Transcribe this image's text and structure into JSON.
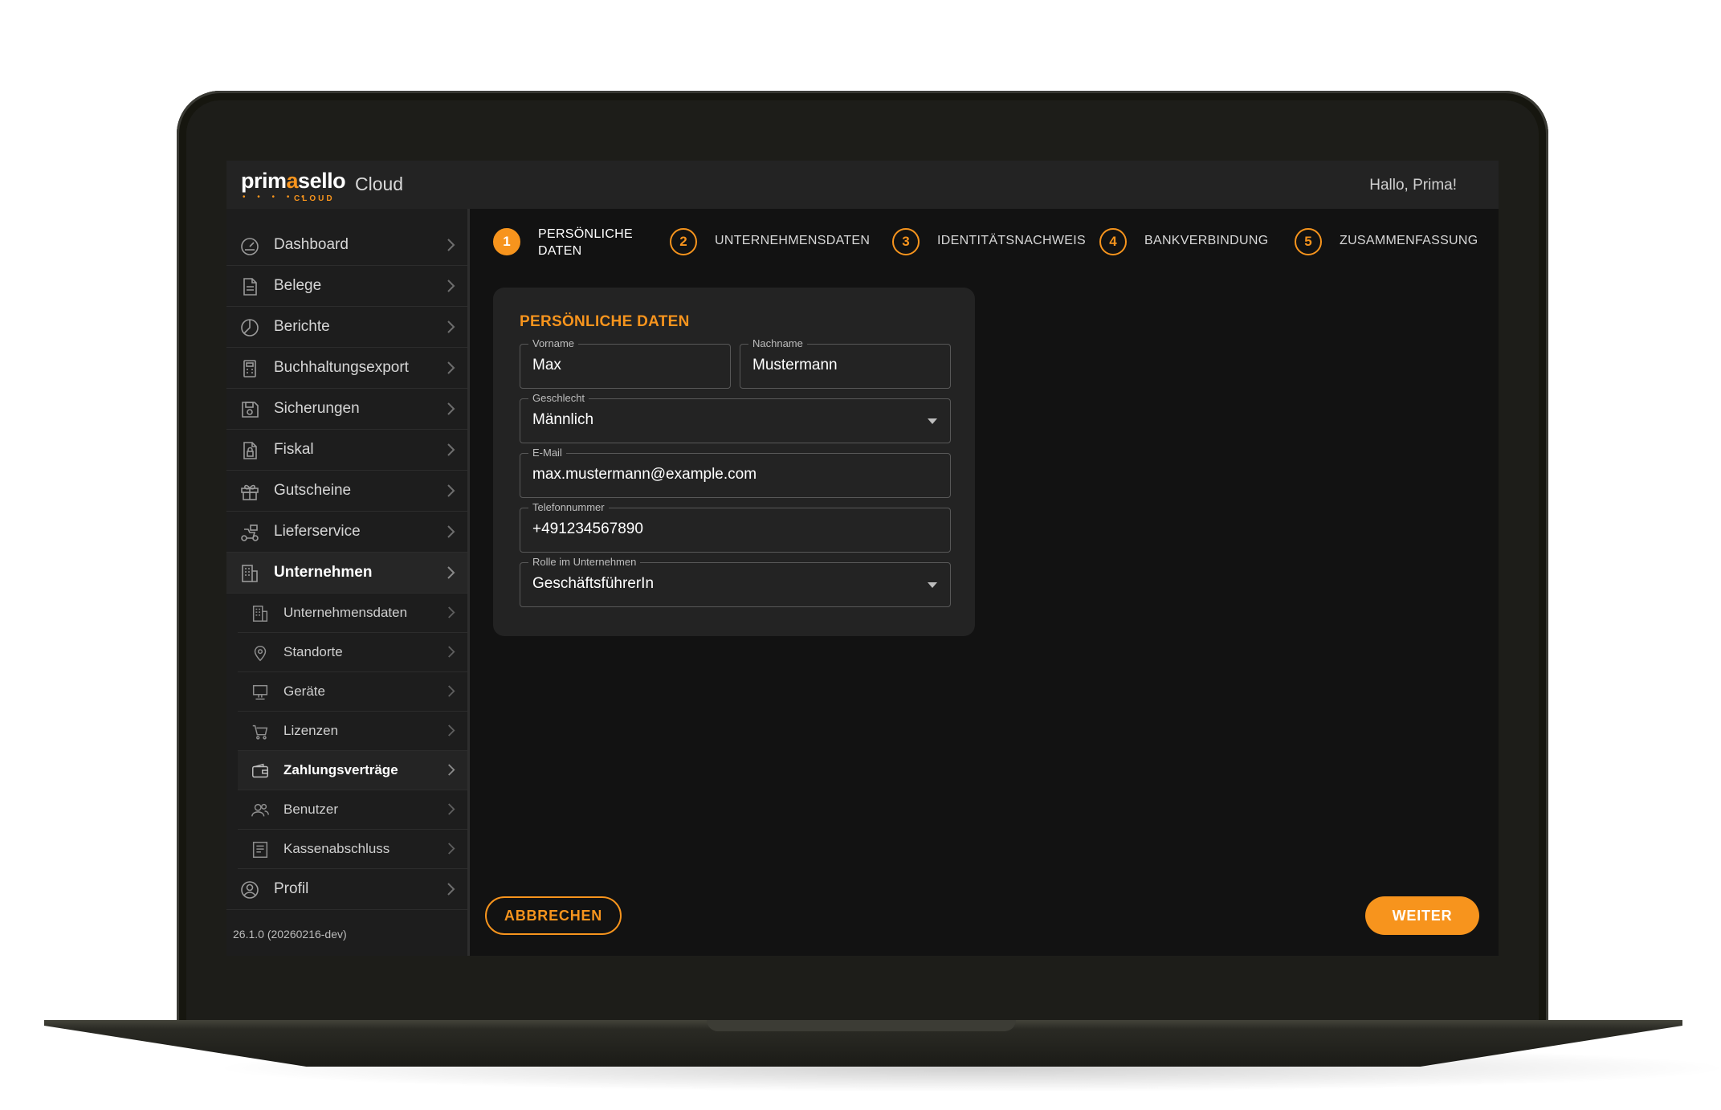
{
  "brand": {
    "logo_word_1": "prim",
    "logo_word_2": "a",
    "logo_word_3": "sello",
    "logo_sub": "CLOUD",
    "app_title": "Cloud"
  },
  "header": {
    "greeting": "Hallo, Prima!"
  },
  "sidebar": {
    "items": [
      {
        "label": "Dashboard",
        "icon": "gauge-icon"
      },
      {
        "label": "Belege",
        "icon": "document-icon"
      },
      {
        "label": "Berichte",
        "icon": "pie-chart-icon"
      },
      {
        "label": "Buchhaltungsexport",
        "icon": "calculator-icon"
      },
      {
        "label": "Sicherungen",
        "icon": "save-disk-icon"
      },
      {
        "label": "Fiskal",
        "icon": "locked-document-icon"
      },
      {
        "label": "Gutscheine",
        "icon": "gift-icon"
      },
      {
        "label": "Lieferservice",
        "icon": "delivery-scooter-icon"
      },
      {
        "label": "Unternehmen",
        "icon": "building-icon"
      }
    ],
    "subitems": [
      {
        "label": "Unternehmensdaten",
        "icon": "building-icon"
      },
      {
        "label": "Standorte",
        "icon": "location-pin-icon"
      },
      {
        "label": "Geräte",
        "icon": "pos-terminal-icon"
      },
      {
        "label": "Lizenzen",
        "icon": "cart-icon"
      },
      {
        "label": "Zahlungsverträge",
        "icon": "wallet-icon"
      },
      {
        "label": "Benutzer",
        "icon": "users-icon"
      },
      {
        "label": "Kassenabschluss",
        "icon": "receipt-icon"
      }
    ],
    "profile": {
      "label": "Profil",
      "icon": "user-circle-icon"
    },
    "version": "26.1.0 (20260216-dev)"
  },
  "stepper": {
    "steps": [
      {
        "number": "1",
        "label": "PERSÖNLICHE DATEN"
      },
      {
        "number": "2",
        "label": "UNTERNEHMENSDATEN"
      },
      {
        "number": "3",
        "label": "IDENTITÄTSNACHWEIS"
      },
      {
        "number": "4",
        "label": "BANKVERBINDUNG"
      },
      {
        "number": "5",
        "label": "ZUSAMMENFASSUNG"
      }
    ],
    "active_step": 1
  },
  "form": {
    "title": "PERSÖNLICHE DATEN",
    "first_name": {
      "label": "Vorname",
      "value": "Max"
    },
    "last_name": {
      "label": "Nachname",
      "value": "Mustermann"
    },
    "gender": {
      "label": "Geschlecht",
      "value": "Männlich"
    },
    "email": {
      "label": "E-Mail",
      "value": "max.mustermann@example.com"
    },
    "phone": {
      "label": "Telefonnummer",
      "value": "+491234567890"
    },
    "role": {
      "label": "Rolle im Unternehmen",
      "value": "GeschäftsführerIn"
    }
  },
  "actions": {
    "cancel": "ABBRECHEN",
    "next": "WEITER"
  },
  "colors": {
    "accent": "#f7941d",
    "background": "#121212",
    "panel": "#232323",
    "sidebar": "#1d1d1d"
  }
}
